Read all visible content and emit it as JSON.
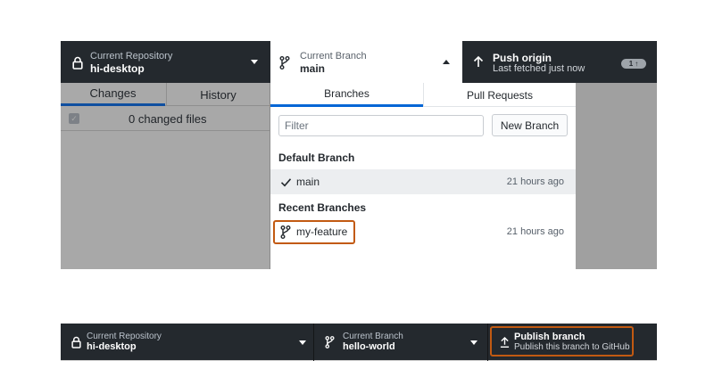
{
  "top": {
    "toolbar": {
      "repository": {
        "label": "Current Repository",
        "name": "hi-desktop",
        "icon": "lock-icon"
      },
      "branch": {
        "label": "Current Branch",
        "name": "main",
        "icon": "git-branch-icon"
      },
      "push": {
        "title": "Push origin",
        "subtitle": "Last fetched just now",
        "badge": "1",
        "icon": "arrow-up-icon"
      }
    },
    "left_panel": {
      "tabs": [
        {
          "label": "Changes"
        },
        {
          "label": "History"
        }
      ],
      "changed_files": "0 changed files"
    },
    "dropdown": {
      "tabs": [
        {
          "label": "Branches"
        },
        {
          "label": "Pull Requests"
        }
      ],
      "filter_placeholder": "Filter",
      "new_branch_label": "New Branch",
      "groups": [
        {
          "header": "Default Branch",
          "branches": [
            {
              "name": "main",
              "time": "21 hours ago",
              "icon": "check-icon",
              "selected": true
            }
          ]
        },
        {
          "header": "Recent Branches",
          "branches": [
            {
              "name": "my-feature",
              "time": "21 hours ago",
              "icon": "git-branch-icon",
              "highlighted": true
            }
          ]
        }
      ]
    }
  },
  "bottom": {
    "toolbar": {
      "repository": {
        "label": "Current Repository",
        "name": "hi-desktop",
        "icon": "lock-icon"
      },
      "branch": {
        "label": "Current Branch",
        "name": "hello-world",
        "icon": "git-branch-icon"
      },
      "publish": {
        "title": "Publish branch",
        "subtitle": "Publish this branch to GitHub",
        "icon": "upload-icon",
        "highlighted": true
      }
    }
  },
  "colors": {
    "toolbar_bg": "#24292e",
    "accent_blue": "#0366d6",
    "highlight_orange": "#c25a12",
    "overlay_gray": "#a0a0a0"
  }
}
